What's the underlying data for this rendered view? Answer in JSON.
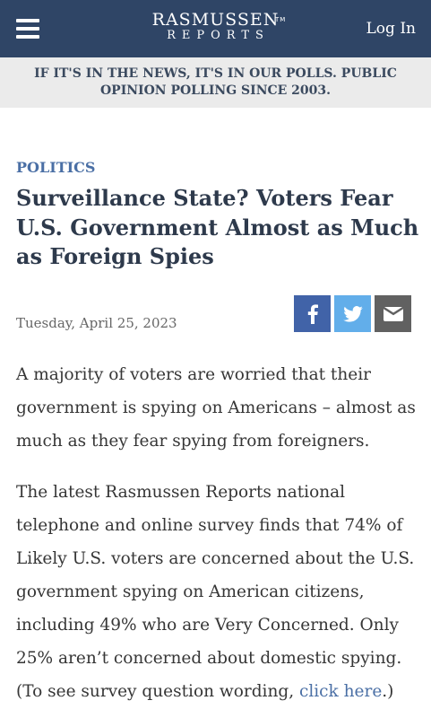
{
  "header": {
    "logo_main": "RASMUSSEN",
    "logo_tm": "TM",
    "logo_sub": "REPORTS",
    "login_label": "Log In"
  },
  "tagline": "IF IT'S IN THE NEWS, IT'S IN OUR POLLS. PUBLIC OPINION POLLING SINCE 2003.",
  "article": {
    "category": "POLITICS",
    "headline": "Surveillance State? Voters Fear U.S. Government Almost as Much as Foreign Spies",
    "date": "Tuesday, April 25, 2023",
    "paragraph1": "A majority of voters are worried that their government is spying on Americans – almost as much as they fear spying from foreigners.",
    "paragraph2_text": "The latest Rasmussen Reports national telephone and online survey finds that 74% of Likely U.S. voters are concerned about the U.S. government spying on American citizens, including 49% who are Very Concerned. Only 25% aren’t concerned about domestic spying. (To see survey question wording, ",
    "paragraph2_link": "click here",
    "paragraph2_end": ".)"
  },
  "share": {
    "icons": [
      "facebook-icon",
      "twitter-icon",
      "email-icon"
    ]
  },
  "colors": {
    "header_bg": "#2f4566",
    "accent": "#4a6fa5",
    "facebook": "#4163a8",
    "twitter": "#62aeea",
    "email": "#616161"
  }
}
